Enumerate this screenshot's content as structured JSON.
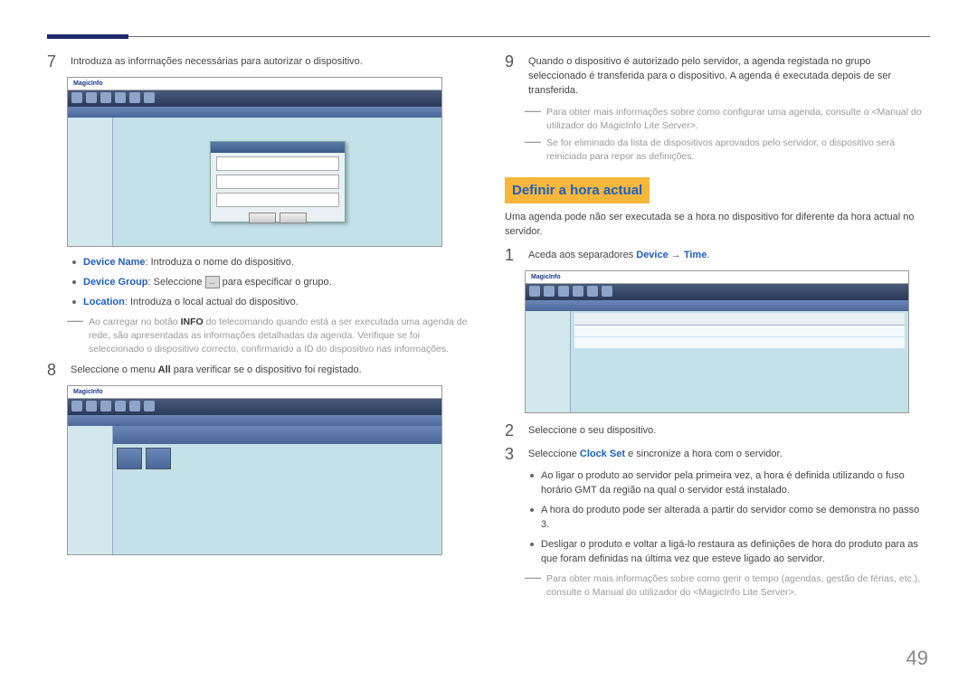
{
  "page_number": "49",
  "left": {
    "step7": "Introduza as informações necessárias para autorizar o dispositivo.",
    "ss_logo": "MagicInfo",
    "b_device_name_label": "Device Name",
    "b_device_name_text": ": Introduza o nome do dispositivo.",
    "b_device_group_label": "Device Group",
    "b_device_group_text_a": ": Seleccione ",
    "b_device_group_text_b": " para especificar o grupo.",
    "b_location_label": "Location",
    "b_location_text": ": Introduza o local actual do dispositivo.",
    "note_info_a": "Ao carregar no botão ",
    "note_info_bold": "INFO",
    "note_info_b": " do telecomando quando está a ser executada uma agenda de rede, são apresentadas as informações detalhadas da agenda. Verifique se foi seleccionado o dispositivo correcto, confirmando a ID do dispositivo nas informações.",
    "step8_a": "Seleccione o menu ",
    "step8_bold": "All",
    "step8_b": " para verificar se o dispositivo foi registado."
  },
  "right": {
    "step9": "Quando o dispositivo é autorizado pelo servidor, a agenda registada no grupo seleccionado é transferida para o dispositivo. A agenda é executada depois de ser transferida.",
    "note9a": "Para obter mais informações sobre como configurar uma agenda, consulte o <Manual do utilizador do MagicInfo Lite Server>.",
    "note9b": "Se for eliminado da lista de dispositivos aprovados pelo servidor, o dispositivo será reiniciado para repor as definições.",
    "heading": "Definir a hora actual",
    "intro": "Uma agenda pode não ser executada se a hora no dispositivo for diferente da hora actual no servidor.",
    "step1_a": "Aceda aos separadores ",
    "step1_device": "Device",
    "step1_arrow": " → ",
    "step1_time": "Time",
    "step1_end": ".",
    "step2": "Seleccione o seu dispositivo.",
    "step3_a": "Seleccione ",
    "step3_clock": "Clock Set",
    "step3_b": " e sincronize a hora com o servidor.",
    "b1": "Ao ligar o produto ao servidor pela primeira vez, a hora é definida utilizando o fuso horário GMT da região na qual o servidor está instalado.",
    "b2": "A hora do produto pode ser alterada a partir do servidor como se demonstra no passo 3.",
    "b3": "Desligar o produto e voltar a ligá-lo restaura as definições de hora do produto para as que foram definidas na última vez que esteve ligado ao servidor.",
    "note_end": "Para obter mais informações sobre como gerir o tempo (agendas, gestão de férias, etc.), consulte o Manual do utilizador do <MagicInfo Lite Server>."
  }
}
